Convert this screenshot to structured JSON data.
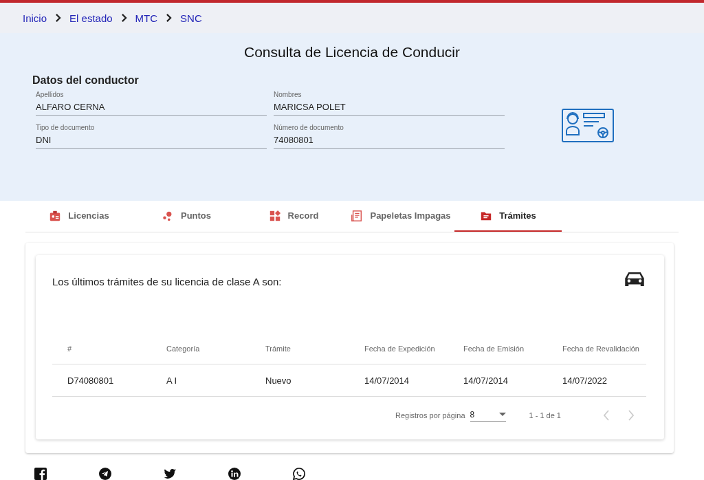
{
  "breadcrumb": [
    "Inicio",
    "El estado",
    "MTC",
    "SNC"
  ],
  "title": "Consulta de Licencia de Conducir",
  "driver": {
    "heading": "Datos del conductor",
    "fields": [
      {
        "label": "Apellidos",
        "value": "ALFARO CERNA"
      },
      {
        "label": "Nombres",
        "value": "MARICSA POLET"
      },
      {
        "label": "Tipo de documento",
        "value": "DNI"
      },
      {
        "label": "Número de documento",
        "value": "74080801"
      }
    ]
  },
  "tabs": [
    {
      "label": "Licencias",
      "kind": "license",
      "selected": false
    },
    {
      "label": "Puntos",
      "kind": "points",
      "selected": false
    },
    {
      "label": "Record",
      "kind": "record",
      "selected": false
    },
    {
      "label": "Papeletas Impagas",
      "kind": "ticket",
      "selected": false
    },
    {
      "label": "Trámites",
      "kind": "folder",
      "selected": true
    }
  ],
  "card": {
    "heading": "Los últimos trámites de su licencia de clase A son:",
    "table": {
      "columns": [
        "#",
        "Categoría",
        "Trámite",
        "Fecha de Expedición",
        "Fecha de Emisión",
        "Fecha de Revalidación"
      ],
      "rows": [
        [
          "D74080801",
          "A I",
          "Nuevo",
          "14/07/2014",
          "14/07/2014",
          "14/07/2022"
        ]
      ]
    },
    "pagination": {
      "label": "Registros por página",
      "per_page": "8",
      "range": "1 - 1 de 1",
      "prev_disabled": true,
      "next_disabled": true
    }
  },
  "social": [
    {
      "kind": "facebook"
    },
    {
      "kind": "telegram"
    },
    {
      "kind": "twitter"
    },
    {
      "kind": "linkedin"
    },
    {
      "kind": "whatsapp"
    }
  ]
}
